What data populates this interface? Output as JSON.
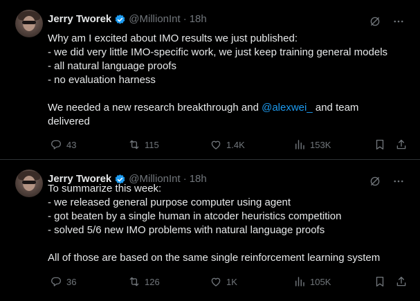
{
  "tweets": [
    {
      "author": {
        "name": "Jerry Tworek",
        "handle": "@MillionInt",
        "verified": true
      },
      "separator": "·",
      "time": "18h",
      "lines": [
        "Why am I excited about IMO results we just published:",
        "- we did very little IMO-specific work, we just keep training general models",
        "- all natural language proofs",
        "- no evaluation harness",
        "",
        "We needed a new research breakthrough and ",
        "delivered"
      ],
      "mention": "@alexwei_",
      "mention_suffix": " and team",
      "stats": {
        "replies": "43",
        "reposts": "115",
        "likes": "1.4K",
        "views": "153K"
      }
    },
    {
      "author": {
        "name": "Jerry Tworek",
        "handle": "@MillionInt",
        "verified": true
      },
      "separator": "·",
      "time": "18h",
      "lines": [
        "To summarize this week:",
        "- we released general purpose computer using agent",
        "- got beaten by a single human in atcoder heuristics competition",
        "- solved 5/6 new IMO problems with natural language proofs",
        "",
        "All of those are based on the same single reinforcement learning system"
      ],
      "stats": {
        "replies": "36",
        "reposts": "126",
        "likes": "1K",
        "views": "105K"
      }
    }
  ],
  "icons": {
    "verified": "verified-badge-icon",
    "grok": "grok-icon",
    "more": "more-icon",
    "reply": "reply-icon",
    "repost": "repost-icon",
    "like": "like-icon",
    "views": "views-icon",
    "bookmark": "bookmark-icon",
    "share": "share-icon"
  },
  "colors": {
    "background": "#000000",
    "text": "#e7e9ea",
    "muted": "#71767b",
    "accent": "#1d9bf0",
    "divider": "#2f3336"
  }
}
